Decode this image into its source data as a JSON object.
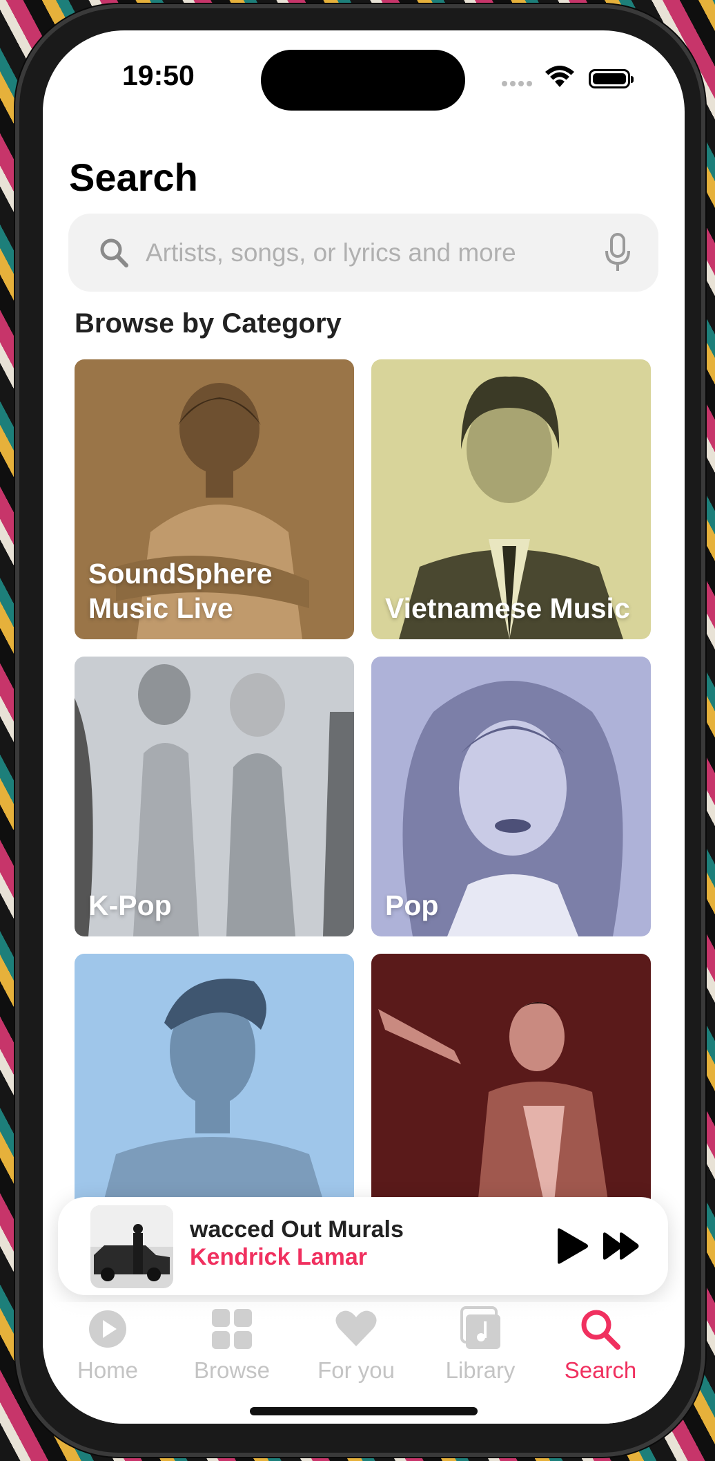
{
  "status": {
    "time": "19:50"
  },
  "page": {
    "title": "Search"
  },
  "search": {
    "placeholder": "Artists, songs, or lyrics and more",
    "icon": "search-icon",
    "mic_icon": "mic-icon"
  },
  "browse": {
    "title": "Browse by Category",
    "categories": [
      {
        "label": "SoundSphere Music Live",
        "tint": "#9a7548"
      },
      {
        "label": "Vietnamese Music",
        "tint": "#d8d49a"
      },
      {
        "label": "K-Pop",
        "tint": "#a9adb3"
      },
      {
        "label": "Pop",
        "tint": "#aeb2d8"
      },
      {
        "label": "",
        "tint": "#9fc6ea"
      },
      {
        "label": "",
        "tint": "#5a1a1a"
      }
    ]
  },
  "now_playing": {
    "title": "wacced Out Murals",
    "artist": "Kendrick Lamar",
    "play_icon": "play-icon",
    "forward_icon": "forward-icon"
  },
  "tabs": [
    {
      "label": "Home",
      "icon": "home-icon",
      "active": false
    },
    {
      "label": "Browse",
      "icon": "grid-icon",
      "active": false
    },
    {
      "label": "For you",
      "icon": "heart-icon",
      "active": false
    },
    {
      "label": "Library",
      "icon": "library-icon",
      "active": false
    },
    {
      "label": "Search",
      "icon": "search-icon",
      "active": true
    }
  ],
  "colors": {
    "accent": "#f0305f",
    "background": "#ffffff"
  }
}
